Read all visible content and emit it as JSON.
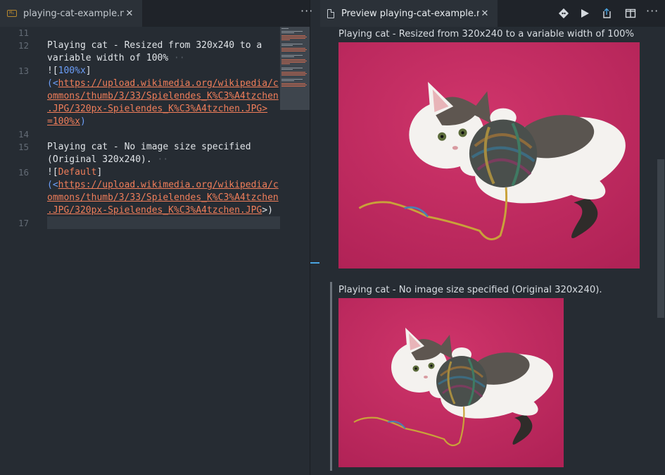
{
  "editor": {
    "tab_label": "playing-cat-example.md",
    "tab_icon": "markdown-icon",
    "lines": [
      {
        "num": "11"
      },
      {
        "num": "12"
      },
      {
        "num": ""
      },
      {
        "num": "13"
      },
      {
        "num": ""
      },
      {
        "num": ""
      },
      {
        "num": ""
      },
      {
        "num": "14"
      },
      {
        "num": "15"
      },
      {
        "num": ""
      },
      {
        "num": "16"
      },
      {
        "num": ""
      },
      {
        "num": ""
      },
      {
        "num": ""
      },
      {
        "num": "17"
      }
    ],
    "text": {
      "l12a": "Playing cat - Resized from 320x240 to a",
      "l12b": "variable width of 100%",
      "l13_open": "![",
      "l13_alt": "100%x",
      "l13_close": "]",
      "l13_paren": "(<",
      "l13_url1": "https://upload.wikimedia.org/wikipedia/c",
      "l13_url2": "ommons/thumb/3/33/Spielendes_K%C3%A4tzchen",
      "l13_url3": ".JPG/320px-Spielendes_K%C3%A4tzchen.JPG>",
      "l13_size": "=100%x",
      "l13_end": ")",
      "l15a": "Playing cat - No image size specified",
      "l15b": "(Original 320x240).",
      "l16_open": "![",
      "l16_alt": "Default",
      "l16_close": "]",
      "l16_paren": "(<",
      "l16_url1": "https://upload.wikimedia.org/wikipedia/c",
      "l16_url2": "ommons/thumb/3/33/Spielendes_K%C3%A4tzchen",
      "l16_url3": ".JPG/320px-Spielendes_K%C3%A4tzchen.JPG",
      "l16_end": ">)"
    }
  },
  "preview": {
    "tab_label": "Preview playing-cat-example.md",
    "caption_a": "Playing cat - Resized from 320x240 to a variable width of 100%",
    "caption_b": "Playing cat - No image size specified (Original 320x240).",
    "toolbar": {
      "open_changes": "git-diff-icon",
      "run": "play-icon",
      "open_source": "open-source-icon",
      "split": "split-editor-icon",
      "more": "ellipsis-icon"
    }
  },
  "colors": {
    "editor_bg": "#262c33",
    "tab_bar_bg": "#1f2329",
    "link": "#f07e5a",
    "alt_text": "#6c9ef8",
    "background_photo": "#c72a63"
  }
}
